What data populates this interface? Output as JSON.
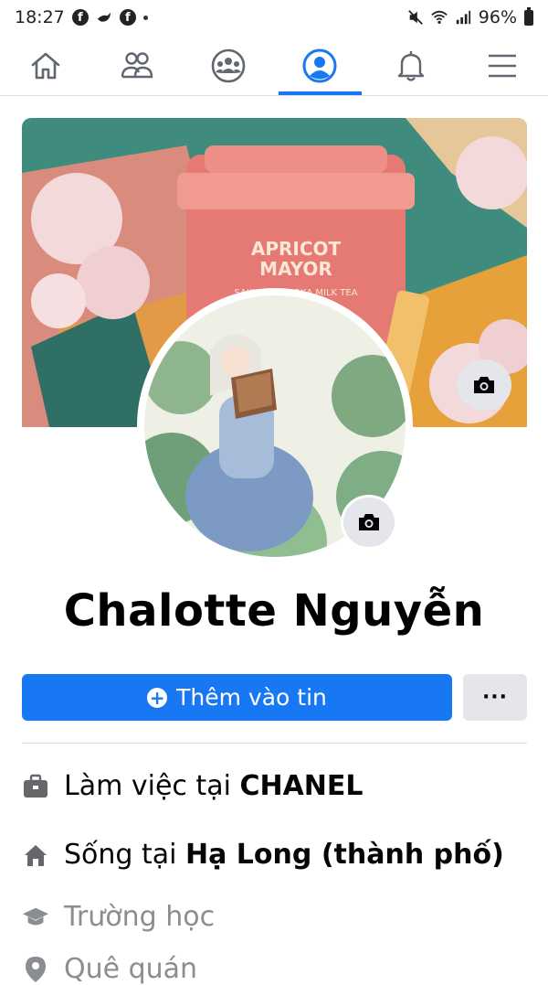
{
  "status_bar": {
    "time": "18:27",
    "battery": "96%",
    "left_icons": [
      "facebook-icon",
      "bird-icon",
      "facebook-icon"
    ],
    "right_icons": [
      "mute-icon",
      "wifi-icon",
      "signal-icon",
      "battery-icon"
    ]
  },
  "nav": {
    "items": [
      {
        "icon": "home-icon"
      },
      {
        "icon": "friends-icon"
      },
      {
        "icon": "groups-icon"
      },
      {
        "icon": "profile-icon",
        "active": true
      },
      {
        "icon": "bell-icon"
      },
      {
        "icon": "menu-icon"
      }
    ],
    "active_color": "#1877f2"
  },
  "cover": {
    "text_line1": "APRICOT",
    "text_line2": "MAYOR",
    "text_line3": "SAKURA TAPIOKA MILK TEA"
  },
  "profile": {
    "name": "Chalotte Nguyễn"
  },
  "actions": {
    "add_story_label": "Thêm vào tin",
    "more_label": "···"
  },
  "intro": {
    "work_prefix": "Làm việc tại ",
    "work_value": "CHANEL",
    "live_prefix": "Sống tại ",
    "live_value": "Hạ Long (thành phố)",
    "school_label": "Trường học",
    "hometown_label": "Quê quán"
  },
  "colors": {
    "accent": "#1877f2",
    "button_gray": "#e4e6eb"
  }
}
